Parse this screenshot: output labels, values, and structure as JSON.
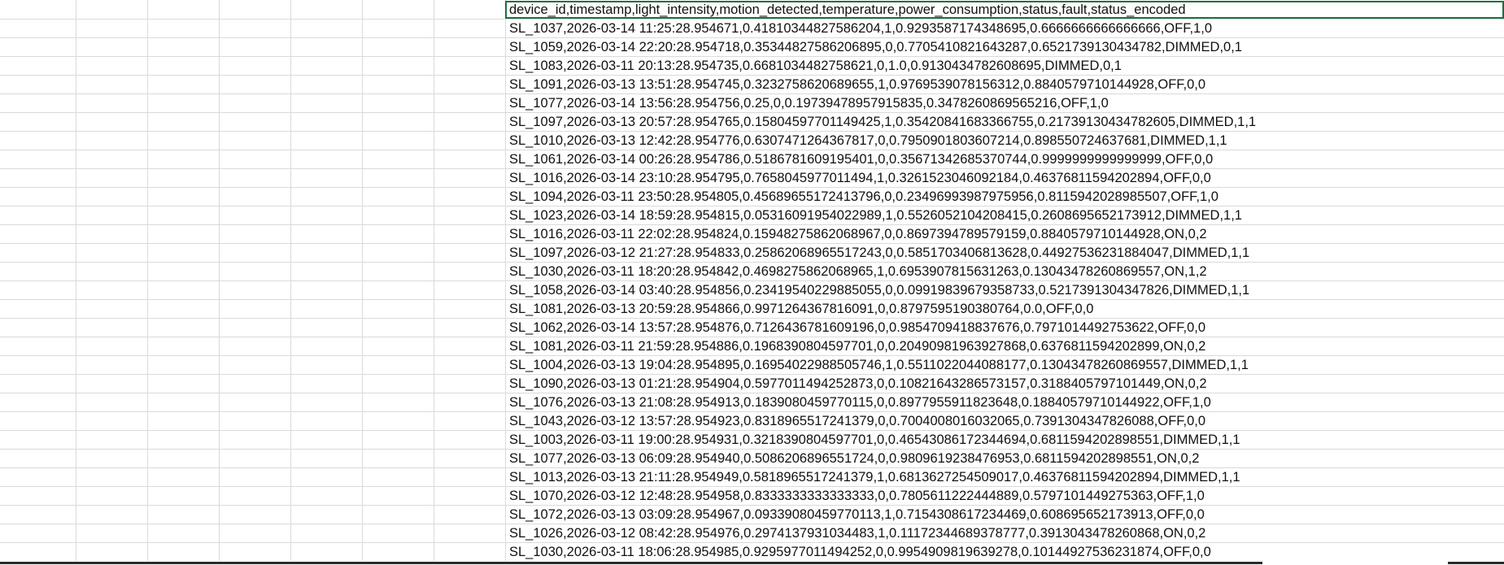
{
  "sheet": {
    "rows": [
      "device_id,timestamp,light_intensity,motion_detected,temperature,power_consumption,status,fault,status_encoded",
      "SL_1037,2026-03-14 11:25:28.954671,0.41810344827586204,1,0.9293587174348695,0.6666666666666666,OFF,1,0",
      "SL_1059,2026-03-14 22:20:28.954718,0.35344827586206895,0,0.7705410821643287,0.6521739130434782,DIMMED,0,1",
      "SL_1083,2026-03-11 20:13:28.954735,0.6681034482758621,0,1.0,0.9130434782608695,DIMMED,0,1",
      "SL_1091,2026-03-13 13:51:28.954745,0.3232758620689655,1,0.9769539078156312,0.8840579710144928,OFF,0,0",
      "SL_1077,2026-03-14 13:56:28.954756,0.25,0,0.19739478957915835,0.3478260869565216,OFF,1,0",
      "SL_1097,2026-03-13 20:57:28.954765,0.15804597701149425,1,0.35420841683366755,0.21739130434782605,DIMMED,1,1",
      "SL_1010,2026-03-13 12:42:28.954776,0.6307471264367817,0,0.7950901803607214,0.898550724637681,DIMMED,1,1",
      "SL_1061,2026-03-14 00:26:28.954786,0.5186781609195401,0,0.35671342685370744,0.9999999999999999,OFF,0,0",
      "SL_1016,2026-03-14 23:10:28.954795,0.7658045977011494,1,0.3261523046092184,0.46376811594202894,OFF,0,0",
      "SL_1094,2026-03-11 23:50:28.954805,0.45689655172413796,0,0.23496993987975956,0.8115942028985507,OFF,1,0",
      "SL_1023,2026-03-14 18:59:28.954815,0.05316091954022989,1,0.5526052104208415,0.2608695652173912,DIMMED,1,1",
      "SL_1016,2026-03-11 22:02:28.954824,0.15948275862068967,0,0.8697394789579159,0.8840579710144928,ON,0,2",
      "SL_1097,2026-03-12 21:27:28.954833,0.25862068965517243,0,0.5851703406813628,0.44927536231884047,DIMMED,1,1",
      "SL_1030,2026-03-11 18:20:28.954842,0.4698275862068965,1,0.6953907815631263,0.13043478260869557,ON,1,2",
      "SL_1058,2026-03-14 03:40:28.954856,0.23419540229885055,0,0.09919839679358733,0.5217391304347826,DIMMED,1,1",
      "SL_1081,2026-03-13 20:59:28.954866,0.9971264367816091,0,0.8797595190380764,0.0,OFF,0,0",
      "SL_1062,2026-03-14 13:57:28.954876,0.7126436781609196,0,0.9854709418837676,0.7971014492753622,OFF,0,0",
      "SL_1081,2026-03-11 21:59:28.954886,0.1968390804597701,0,0.20490981963927868,0.6376811594202899,ON,0,2",
      "SL_1004,2026-03-13 19:04:28.954895,0.16954022988505746,1,0.5511022044088177,0.13043478260869557,DIMMED,1,1",
      "SL_1090,2026-03-13 01:21:28.954904,0.5977011494252873,0,0.10821643286573157,0.3188405797101449,ON,0,2",
      "SL_1076,2026-03-13 21:08:28.954913,0.1839080459770115,0,0.8977955911823648,0.18840579710144922,OFF,1,0",
      "SL_1043,2026-03-12 13:57:28.954923,0.8318965517241379,0,0.7004008016032065,0.7391304347826088,OFF,0,0",
      "SL_1003,2026-03-11 19:00:28.954931,0.3218390804597701,0,0.46543086172344694,0.6811594202898551,DIMMED,1,1",
      "SL_1077,2026-03-13 06:09:28.954940,0.5086206896551724,0,0.9809619238476953,0.6811594202898551,ON,0,2",
      "SL_1013,2026-03-13 21:11:28.954949,0.5818965517241379,1,0.6813627254509017,0.46376811594202894,DIMMED,1,1",
      "SL_1070,2026-03-12 12:48:28.954958,0.8333333333333333,0,0.7805611222444889,0.5797101449275363,OFF,1,0",
      "SL_1072,2026-03-13 03:09:28.954967,0.09339080459770113,1,0.7154308617234469,0.608695652173913,OFF,0,0",
      "SL_1026,2026-03-12 08:42:28.954976,0.2974137931034483,1,0.11172344689378777,0.3913043478260868,ON,0,2",
      "SL_1030,2026-03-11 18:06:28.954985,0.9295977011494252,0,0.9954909819639278,0.10144927536231874,OFF,0,0"
    ]
  },
  "colors": {
    "gridline": "#dadada",
    "selection_border": "#1e6f41",
    "text": "#111111"
  }
}
